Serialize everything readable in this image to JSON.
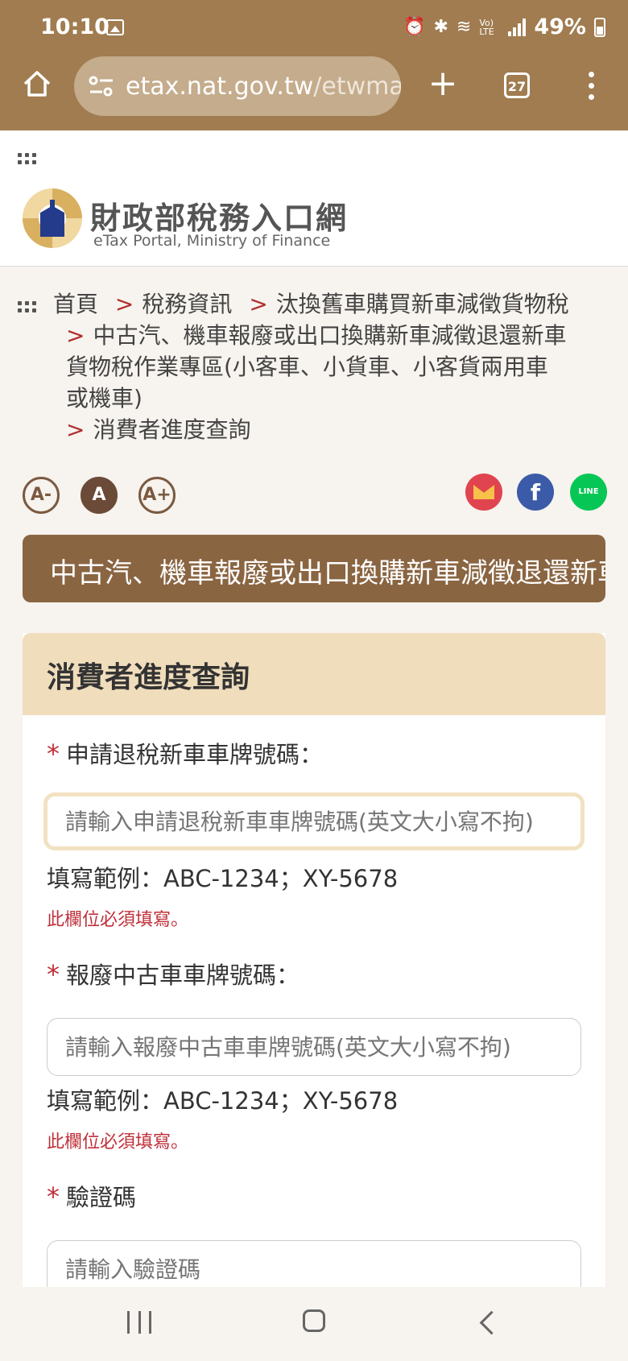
{
  "status": {
    "time": "10:10",
    "battery": "49%",
    "net": "Vo) LTE"
  },
  "browser": {
    "url_host": "etax.nat.gov.tw",
    "url_path": "/etwmai",
    "tab_count": "27"
  },
  "site": {
    "title": "財政部稅務入口網",
    "subtitle": "eTax Portal, Ministry of Finance"
  },
  "breadcrumb": {
    "items": [
      "首頁",
      "稅務資訊",
      "汰換舊車購買新車減徵貨物稅",
      "中古汽、機車報廢或出口換購新車減徵退還新車貨物稅作業專區(小客車、小貨車、小客貨兩用車或機車)",
      "消費者進度查詢"
    ],
    "line3a": "中古汽、機車報廢或出口換購新車減徵退還新車",
    "line3b": "貨物稅作業專區(小客車、小貨車、小客貨兩用車",
    "line3c": "或機車)"
  },
  "font_controls": {
    "small": "A-",
    "normal": "A",
    "large": "A+"
  },
  "share": {
    "line_label": "LINE",
    "fb_label": "f"
  },
  "banner": {
    "text": "中古汽、機車報廢或出口換購新車減徵退還新車"
  },
  "form": {
    "heading": "消費者進度查詢",
    "required_mark": "*",
    "fields": [
      {
        "label": "申請退稅新車車牌號碼：",
        "placeholder": "請輸入申請退稅新車車牌號碼(英文大小寫不拘)",
        "example": "填寫範例：ABC-1234；XY-5678",
        "error": "此欄位必須填寫。"
      },
      {
        "label": "報廢中古車車牌號碼：",
        "placeholder": "請輸入報廢中古車車牌號碼(英文大小寫不拘)",
        "example": "填寫範例：ABC-1234；XY-5678",
        "error": "此欄位必須填寫。"
      },
      {
        "label": "驗證碼",
        "placeholder": "請輸入驗證碼"
      }
    ]
  },
  "colors": {
    "chrome": "#a07c50",
    "banner": "#8a6542",
    "card_head": "#f0ddbc",
    "required": "#c0303a"
  }
}
